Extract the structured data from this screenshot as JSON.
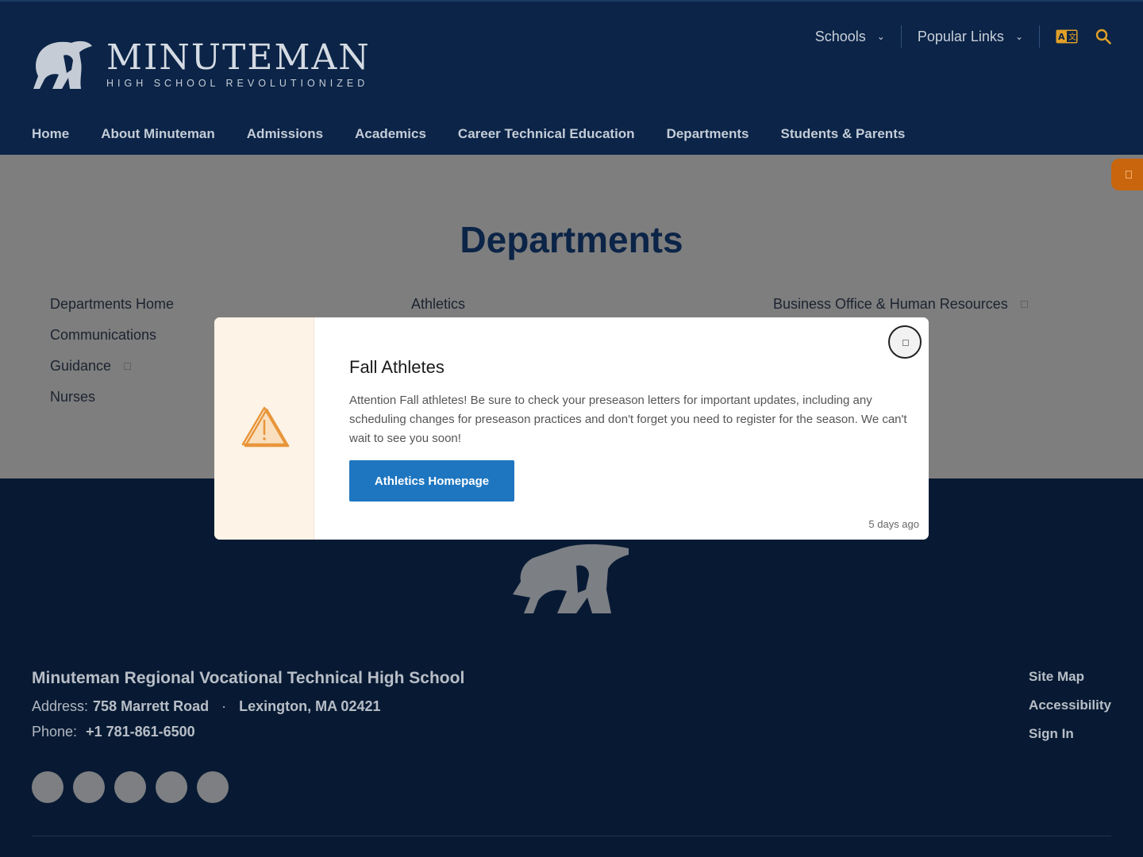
{
  "header": {
    "logo": {
      "wordmark": "MINUTEMAN",
      "tagline": "HIGH SCHOOL REVOLUTIONIZED",
      "icon": "minuteman-head-icon"
    },
    "utility": [
      {
        "label": "Schools",
        "icon": "chevron-down-icon"
      },
      {
        "label": "Popular Links",
        "icon": "chevron-down-icon"
      }
    ],
    "icons": [
      "translate-icon",
      "search-icon"
    ],
    "nav": [
      "Home",
      "About Minuteman",
      "Admissions",
      "Academics",
      "Career Technical Education",
      "Departments",
      "Students & Parents"
    ]
  },
  "content": {
    "title": "Departments",
    "columns": [
      [
        "Departments Home",
        "Communications",
        "Guidance",
        "Nurses"
      ],
      [
        "Athletics"
      ],
      [
        "Business Office & Human Resources"
      ]
    ],
    "side_tab_color": "#c9650c"
  },
  "modal": {
    "title": "Fall Athletes",
    "body": "Attention Fall athletes! Be sure to check your preseason letters for important updates, including any scheduling changes for preseason practices and don't forget you need to register for the season. We can't wait to see you soon!",
    "button_label": "Athletics Homepage",
    "timestamp": "5 days ago",
    "icon": "warning-icon",
    "accent": "#e8953a",
    "button_color": "#1e76c0"
  },
  "footer": {
    "school_name": "Minuteman Regional Vocational Technical High School",
    "address_label": "Address:",
    "address_street": "758 Marrett Road",
    "address_separator": "·",
    "address_city": "Lexington, MA 02421",
    "phone_label": "Phone:",
    "phone": "+1 781-861-6500",
    "links": [
      "Site Map",
      "Accessibility",
      "Sign In"
    ],
    "social_count": 5
  },
  "colors": {
    "navy": "#0b2447",
    "footer": "#081a33",
    "overlay_gray": "#7e7e7e"
  }
}
